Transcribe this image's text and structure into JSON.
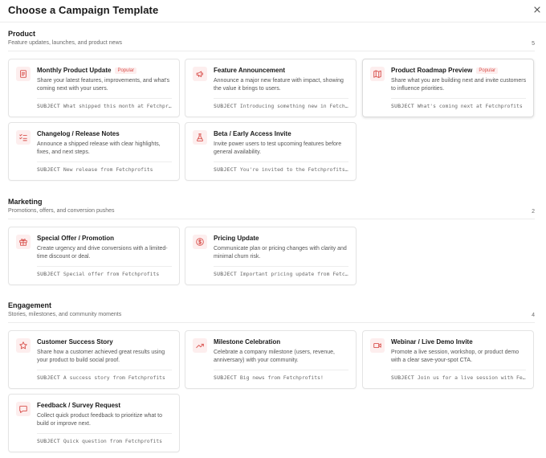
{
  "modal": {
    "title": "Choose a Campaign Template"
  },
  "subject_label": "SUBJECT",
  "colors": {
    "accent": "#d9534f",
    "icon_bg": "#fdeeee"
  },
  "sections": [
    {
      "title": "Product",
      "description": "Feature updates, launches, and product news",
      "count": "5",
      "templates": [
        {
          "title": "Monthly Product Update",
          "badge": "Popular",
          "icon": "document-icon",
          "description": "Share your latest features, improvements, and what's coming next with your users.",
          "subject": "What shipped this month at Fetchprofits"
        },
        {
          "title": "Feature Announcement",
          "badge": "",
          "icon": "megaphone-icon",
          "description": "Announce a major new feature with impact, showing the value it brings to users.",
          "subject": "Introducing something new in Fetchprofits"
        },
        {
          "title": "Product Roadmap Preview",
          "badge": "Popular",
          "icon": "map-icon",
          "description": "Share what you are building next and invite customers to influence priorities.",
          "subject": "What's coming next at Fetchprofits"
        },
        {
          "title": "Changelog / Release Notes",
          "badge": "",
          "icon": "checklist-icon",
          "description": "Announce a shipped release with clear highlights, fixes, and next steps.",
          "subject": "New release from Fetchprofits"
        },
        {
          "title": "Beta / Early Access Invite",
          "badge": "",
          "icon": "flask-icon",
          "description": "Invite power users to test upcoming features before general availability.",
          "subject": "You're invited to the Fetchprofits beta"
        }
      ]
    },
    {
      "title": "Marketing",
      "description": "Promotions, offers, and conversion pushes",
      "count": "2",
      "templates": [
        {
          "title": "Special Offer / Promotion",
          "badge": "",
          "icon": "gift-icon",
          "description": "Create urgency and drive conversions with a limited-time discount or deal.",
          "subject": "Special offer from Fetchprofits"
        },
        {
          "title": "Pricing Update",
          "badge": "",
          "icon": "dollar-circle-icon",
          "description": "Communicate plan or pricing changes with clarity and minimal churn risk.",
          "subject": "Important pricing update from Fetchprofits"
        }
      ]
    },
    {
      "title": "Engagement",
      "description": "Stories, milestones, and community moments",
      "count": "4",
      "templates": [
        {
          "title": "Customer Success Story",
          "badge": "",
          "icon": "star-icon",
          "description": "Share how a customer achieved great results using your product to build social proof.",
          "subject": "A success story from Fetchprofits"
        },
        {
          "title": "Milestone Celebration",
          "badge": "",
          "icon": "trending-up-icon",
          "description": "Celebrate a company milestone (users, revenue, anniversary) with your community.",
          "subject": "Big news from Fetchprofits!"
        },
        {
          "title": "Webinar / Live Demo Invite",
          "badge": "",
          "icon": "video-icon",
          "description": "Promote a live session, workshop, or product demo with a clear save-your-spot CTA.",
          "subject": "Join us for a live session with Fetchprofits"
        },
        {
          "title": "Feedback / Survey Request",
          "badge": "",
          "icon": "chat-icon",
          "description": "Collect quick product feedback to prioritize what to build or improve next.",
          "subject": "Quick question from Fetchprofits"
        }
      ]
    }
  ]
}
